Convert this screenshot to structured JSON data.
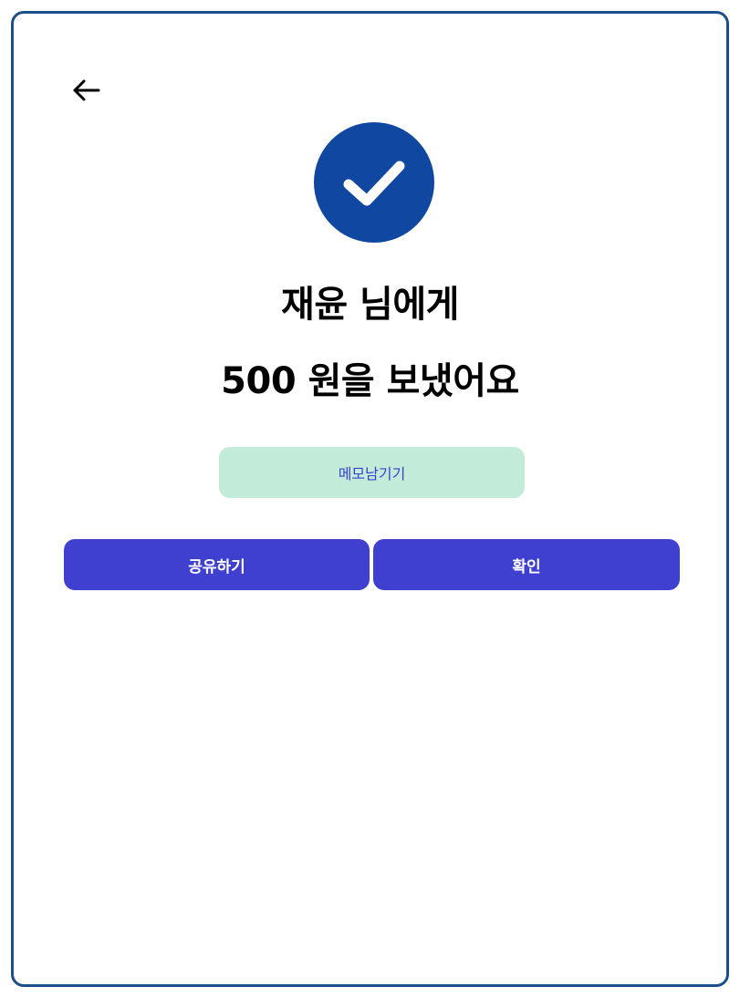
{
  "header": {
    "back_icon": "arrow-left-icon"
  },
  "status": {
    "icon": "check-circle-icon",
    "line1": "재윤 님에게",
    "line2": "500 원을 보냈어요"
  },
  "memo": {
    "label": "메모남기기"
  },
  "actions": {
    "share_label": "공유하기",
    "confirm_label": "확인"
  },
  "colors": {
    "frame_border": "#1a4f8c",
    "check_bg": "#0f47a1",
    "memo_bg": "#c3ebd9",
    "memo_text": "#3b3fd0",
    "primary_button": "#4040d0"
  }
}
